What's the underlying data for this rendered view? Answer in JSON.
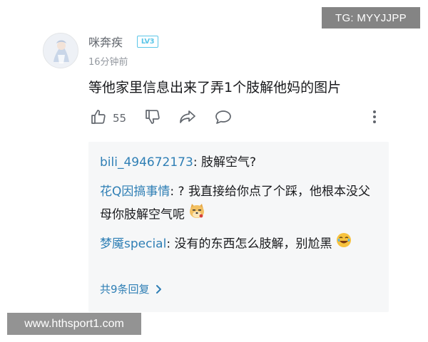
{
  "watermarks": {
    "top_right": "TG: MYYJJPP",
    "bottom_left": "www.hthsport1.com"
  },
  "comment": {
    "username": "咪奔疾",
    "level_badge": "LV3",
    "time": "16分钟前",
    "text": "等他家里信息出来了弄1个肢解他妈的图片",
    "likes": "55",
    "icons": [
      "thumbs-up-icon",
      "thumbs-down-icon",
      "share-icon",
      "reply-bubble-icon",
      "more-vertical-icon"
    ]
  },
  "replies": [
    {
      "name": "bili_494672173",
      "sep": ": ",
      "text": "肢解空气?"
    },
    {
      "name": "花Q因搞事情",
      "sep": ": ",
      "text": "? 我直接给你点了个踩，他根本没父母你肢解空气呢",
      "emoji": "doge-emoji"
    },
    {
      "name": "梦魇special",
      "sep": ": ",
      "text": "没有的东西怎么肢解，别尬黑",
      "emoji": "laugh-emoji"
    }
  ],
  "more_replies_label": "共9条回复",
  "colors": {
    "link_blue": "#2f7fb5",
    "badge": "#5bc6e8",
    "reply_bg": "#f6f7f8",
    "icon_gray": "#61666d"
  }
}
